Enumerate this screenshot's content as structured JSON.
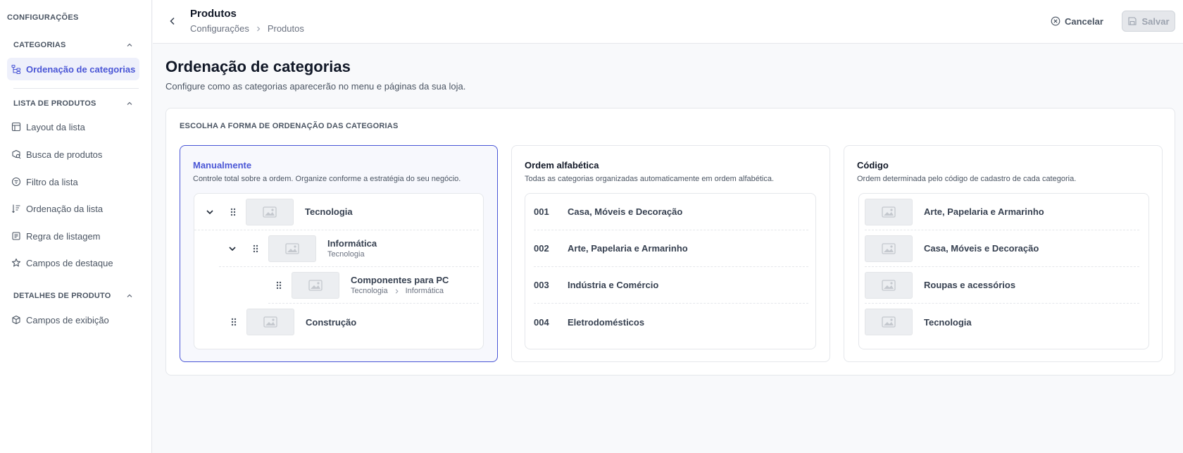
{
  "sidebar": {
    "title": "CONFIGURAÇÕES",
    "sections": [
      {
        "label": "CATEGORIAS",
        "items": [
          {
            "label": "Ordenação de categorias",
            "icon": "category-tree-icon",
            "active": true
          }
        ]
      },
      {
        "label": "LISTA DE PRODUTOS",
        "items": [
          {
            "label": "Layout da lista",
            "icon": "table-layout-icon"
          },
          {
            "label": "Busca de produtos",
            "icon": "search-products-icon"
          },
          {
            "label": "Filtro da lista",
            "icon": "filter-icon"
          },
          {
            "label": "Ordenação da lista",
            "icon": "sort-icon"
          },
          {
            "label": "Regra de listagem",
            "icon": "rule-icon"
          },
          {
            "label": "Campos de destaque",
            "icon": "star-icon"
          }
        ]
      },
      {
        "label": "DETALHES DE PRODUTO",
        "items": [
          {
            "label": "Campos de exibição",
            "icon": "box-icon"
          }
        ]
      }
    ]
  },
  "topbar": {
    "title": "Produtos",
    "breadcrumb": [
      "Configurações",
      "Produtos"
    ],
    "cancel_label": "Cancelar",
    "save_label": "Salvar"
  },
  "page": {
    "title": "Ordenação de categorias",
    "subtitle": "Configure como as categorias aparecerão no menu e páginas da sua loja."
  },
  "panel": {
    "label": "ESCOLHA A FORMA DE ORDENAÇÃO DAS CATEGORIAS",
    "options": [
      {
        "title": "Manualmente",
        "description": "Controle total sobre a ordem. Organize conforme a estratégia do seu negócio.",
        "selected": true,
        "rows": [
          {
            "name": "Tecnologia",
            "path": []
          },
          {
            "name": "Informática",
            "path": [
              "Tecnologia"
            ]
          },
          {
            "name": "Componentes para PC",
            "path": [
              "Tecnologia",
              "Informática"
            ]
          },
          {
            "name": "Construção",
            "path": []
          }
        ]
      },
      {
        "title": "Ordem alfabética",
        "description": "Todas as categorias organizadas automaticamente em ordem alfabética.",
        "selected": false,
        "rows": [
          {
            "code": "001",
            "name": "Casa, Móveis e Decoração"
          },
          {
            "code": "002",
            "name": "Arte, Papelaria e Armarinho"
          },
          {
            "code": "003",
            "name": "Indústria e Comércio"
          },
          {
            "code": "004",
            "name": "Eletrodomésticos"
          }
        ]
      },
      {
        "title": "Código",
        "description": "Ordem determinada pelo código de cadastro de cada categoria.",
        "selected": false,
        "rows": [
          {
            "name": "Arte, Papelaria e Armarinho"
          },
          {
            "name": "Casa, Móveis e Decoração"
          },
          {
            "name": "Roupas e acessórios"
          },
          {
            "name": "Tecnologia"
          }
        ]
      }
    ]
  },
  "colors": {
    "accent": "#4a56d6",
    "selected_bg": "#f7f8fd",
    "border": "#e5e7eb"
  }
}
